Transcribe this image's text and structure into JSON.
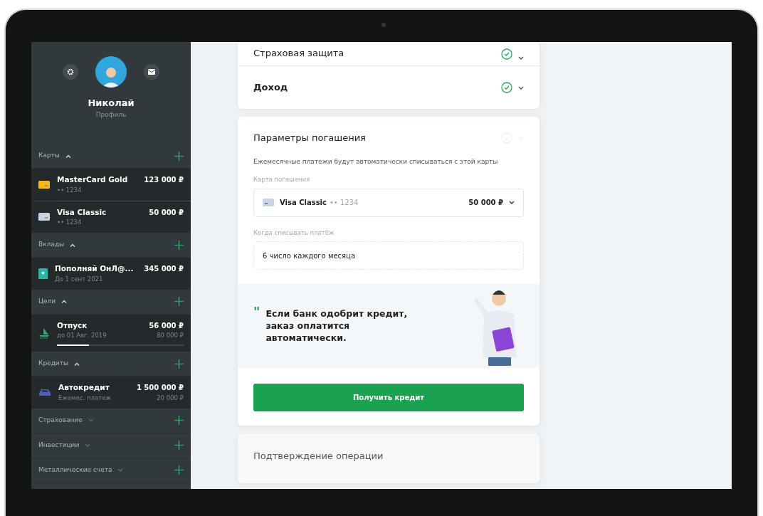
{
  "profile": {
    "name": "Николай",
    "subtitle": "Профиль"
  },
  "sidebar": {
    "sections": [
      {
        "title": "Карты",
        "expanded": true,
        "items": [
          {
            "kind": "card",
            "color": "#f2b824",
            "name": "MasterCard Gold",
            "detail": "•• 1234",
            "amount": "123 000 ₽"
          },
          {
            "kind": "card",
            "color": "#c9d3e6",
            "name": "Visa Classic",
            "detail": "•• 1234",
            "amount": "50 000 ₽"
          }
        ]
      },
      {
        "title": "Вклады",
        "expanded": true,
        "items": [
          {
            "kind": "deposit",
            "name": "Пополняй ОнЛ@...",
            "detail": "До 1 сент 2021",
            "amount": "345 000 ₽"
          }
        ]
      },
      {
        "title": "Цели",
        "expanded": true,
        "items": [
          {
            "kind": "goal",
            "name": "Отпуск",
            "detail": "до 01 Авг. 2019",
            "amount": "56 000 ₽",
            "target": "80 000 ₽",
            "level": 0.25
          }
        ]
      },
      {
        "title": "Кредиты",
        "expanded": true,
        "items": [
          {
            "kind": "loan",
            "name": "Автокредит",
            "detail": "Ежемес. платеж",
            "amount": "1 500 000 ₽",
            "target": "20 000 ₽"
          }
        ]
      },
      {
        "title": "Страхование",
        "expanded": false
      },
      {
        "title": "Инвестиции",
        "expanded": false
      },
      {
        "title": "Металлические счета",
        "expanded": false
      }
    ]
  },
  "steps": [
    {
      "title": "Страховая защита",
      "done": true
    },
    {
      "title": "Доход",
      "done": true
    }
  ],
  "repayment": {
    "title": "Параметры погашения",
    "done": false,
    "description": "Ежемесячные платежи будут автоматически списываться с этой карты",
    "card_label": "Карта погашения",
    "card_name": "Visa Classic",
    "card_number": "•• 1234",
    "card_amount": "50 000 ₽",
    "date_label": "Когда списывать платёж",
    "date_value": "6 число каждого месяца",
    "quote_mark": "\"",
    "quote": "Если банк одобрит кредит, заказ оплатится автоматически.",
    "button": "Получить кредит"
  },
  "next_step": {
    "title": "Подтверждение операции"
  }
}
